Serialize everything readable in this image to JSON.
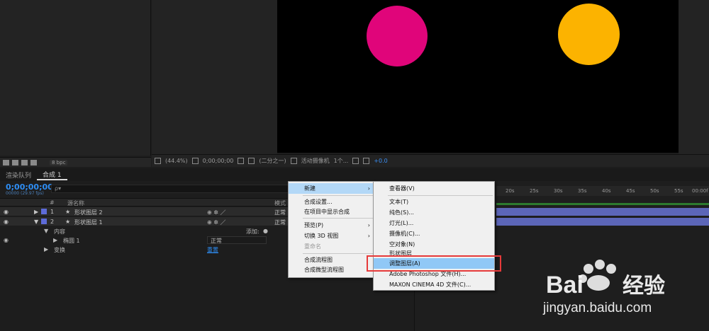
{
  "viewer": {
    "zoom": "(44.4%)",
    "timecode": "0;00;00;00",
    "resolution": "(二分之一)",
    "camera": "活动摄像机",
    "views": "1个...",
    "exposure": "+0.0"
  },
  "project": {
    "bpc": "8 bpc"
  },
  "timeline": {
    "tab_render": "渲染队列",
    "tab_comp": "合成 1",
    "timecode": "0;00;00;00",
    "fps": "00000 (29.97 fps)",
    "search_placeholder": "ρ▾",
    "col_hash": "#",
    "col_source": "源名称",
    "col_mode": "模式",
    "layers": [
      {
        "num": "1",
        "name": "形状图层 2",
        "mode": "正常"
      },
      {
        "num": "2",
        "name": "形状图层 1",
        "mode": "正常"
      }
    ],
    "contents_label": "内容",
    "add_label": "添加:",
    "ellipse_label": "椭圆 1",
    "ellipse_mode": "正常",
    "transform_label": "变换",
    "reset_label": "重置",
    "ruler": [
      "20s",
      "25s",
      "30s",
      "35s",
      "40s",
      "45s",
      "50s",
      "55s",
      "00:00f"
    ]
  },
  "menu_main": {
    "items": [
      "新建",
      "合成设置...",
      "在项目中显示合成",
      "预览(P)",
      "切换 3D 视图",
      "重命名",
      "合成流程图",
      "合成微型流程图"
    ]
  },
  "menu_new": {
    "items": [
      "查看器(V)",
      "文本(T)",
      "纯色(S)...",
      "灯光(L)...",
      "摄像机(C)...",
      "空对象(N)",
      "形状图层",
      "调整图层(A)",
      "Adobe Photoshop 文件(H)...",
      "MAXON CINEMA 4D 文件(C)..."
    ]
  },
  "watermark": {
    "brand": "Bai 经验",
    "url": "jingyan.baidu.com"
  },
  "colors": {
    "pink": "#e0057a",
    "orange": "#fcb300",
    "accent": "#2e8ef5",
    "highlight": "#90c8f6",
    "red_frame": "#e63a3a"
  }
}
